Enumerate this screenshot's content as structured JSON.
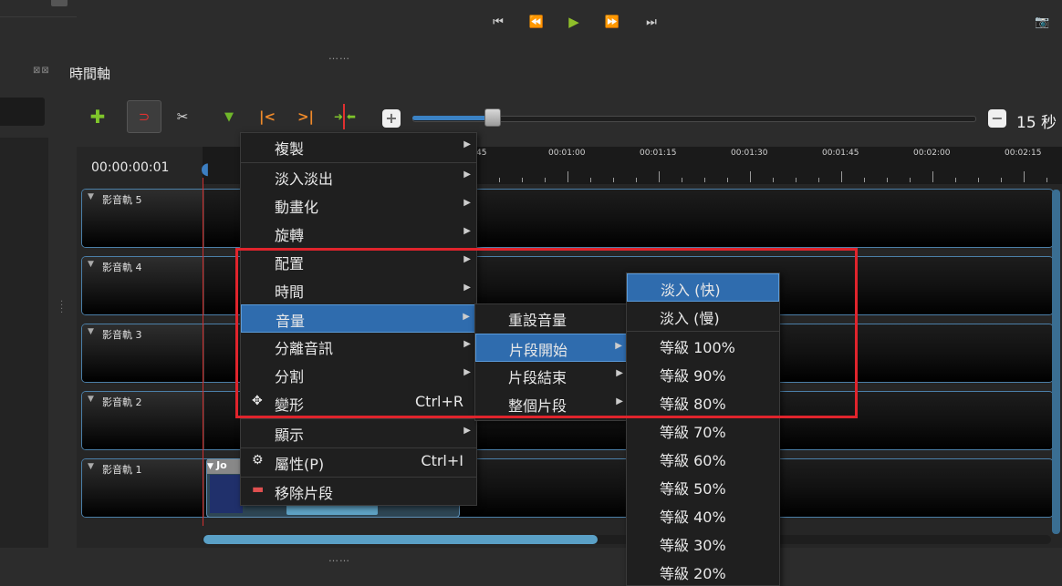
{
  "playback": {
    "controls": [
      "⏮",
      "⏪",
      "▶",
      "⏩",
      "⏭"
    ]
  },
  "grip": "……",
  "timeline_panel": {
    "title": "時間軸",
    "title_icons": "⊠⊠"
  },
  "toolbar": {
    "zoom_label": "15 秒"
  },
  "ruler": {
    "timecode": "00:00:00:01",
    "ticks": [
      ":45",
      "00:01:00",
      "00:01:15",
      "00:01:30",
      "00:01:45",
      "00:02:00",
      "00:02:15"
    ]
  },
  "tracks": [
    "影音軌 5",
    "影音軌 4",
    "影音軌 3",
    "影音軌 2",
    "影音軌 1"
  ],
  "clip": {
    "title": "Jo"
  },
  "context_menu": [
    {
      "label": "複製",
      "arrow": "▶"
    },
    {
      "label": "淡入淡出",
      "arrow": "▶"
    },
    {
      "label": "動畫化",
      "arrow": "▶"
    },
    {
      "label": "旋轉",
      "arrow": "▶"
    },
    {
      "label": "配置",
      "arrow": "▶"
    },
    {
      "label": "時間",
      "arrow": "▶"
    },
    {
      "label": "音量",
      "arrow": "▶"
    },
    {
      "label": "分離音訊",
      "arrow": "▶"
    },
    {
      "label": "分割",
      "arrow": "▶"
    },
    {
      "label": "變形",
      "shortcut": "Ctrl+R",
      "icon": "move-icon"
    },
    {
      "label": "顯示",
      "arrow": "▶"
    },
    {
      "label": "屬性(P)",
      "shortcut": "Ctrl+I",
      "icon": "gear-icon"
    },
    {
      "label": "移除片段",
      "icon": "remove-icon"
    }
  ],
  "volume_submenu": [
    {
      "label": "重設音量"
    },
    {
      "label": "片段開始",
      "arrow": "▶"
    },
    {
      "label": "片段結束",
      "arrow": "▶"
    },
    {
      "label": "整個片段",
      "arrow": "▶"
    }
  ],
  "fade_submenu": [
    "淡入 (快)",
    "淡入 (慢)",
    "等級 100%",
    "等級 90%",
    "等級 80%",
    "等級 70%",
    "等級 60%",
    "等級 50%",
    "等級 40%",
    "等級 30%",
    "等級 20%"
  ],
  "colors": {
    "highlight_box": "#e0242c",
    "selection": "#2f6cae",
    "playhead": "#d03030"
  }
}
